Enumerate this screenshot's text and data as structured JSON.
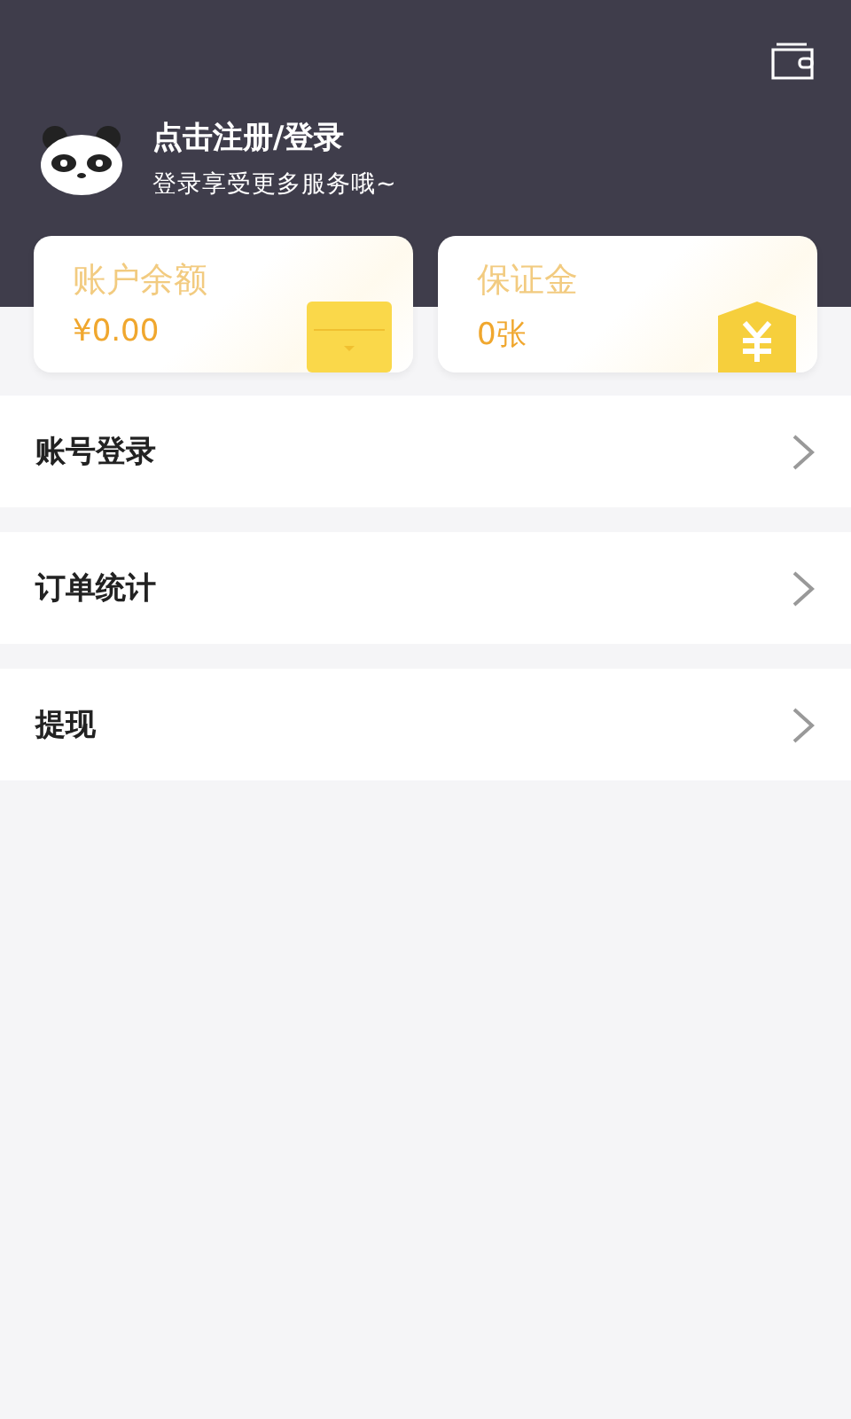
{
  "header": {
    "title": "点击注册/登录",
    "subtitle": "登录享受更多服务哦~"
  },
  "cards": [
    {
      "kind": "balance",
      "label": "账户余额",
      "value": "¥0.00"
    },
    {
      "kind": "deposit",
      "label": "保证金",
      "value": "0张"
    }
  ],
  "menu": [
    {
      "label": "账号登录"
    },
    {
      "label": "订单统计"
    },
    {
      "label": "提现"
    }
  ]
}
